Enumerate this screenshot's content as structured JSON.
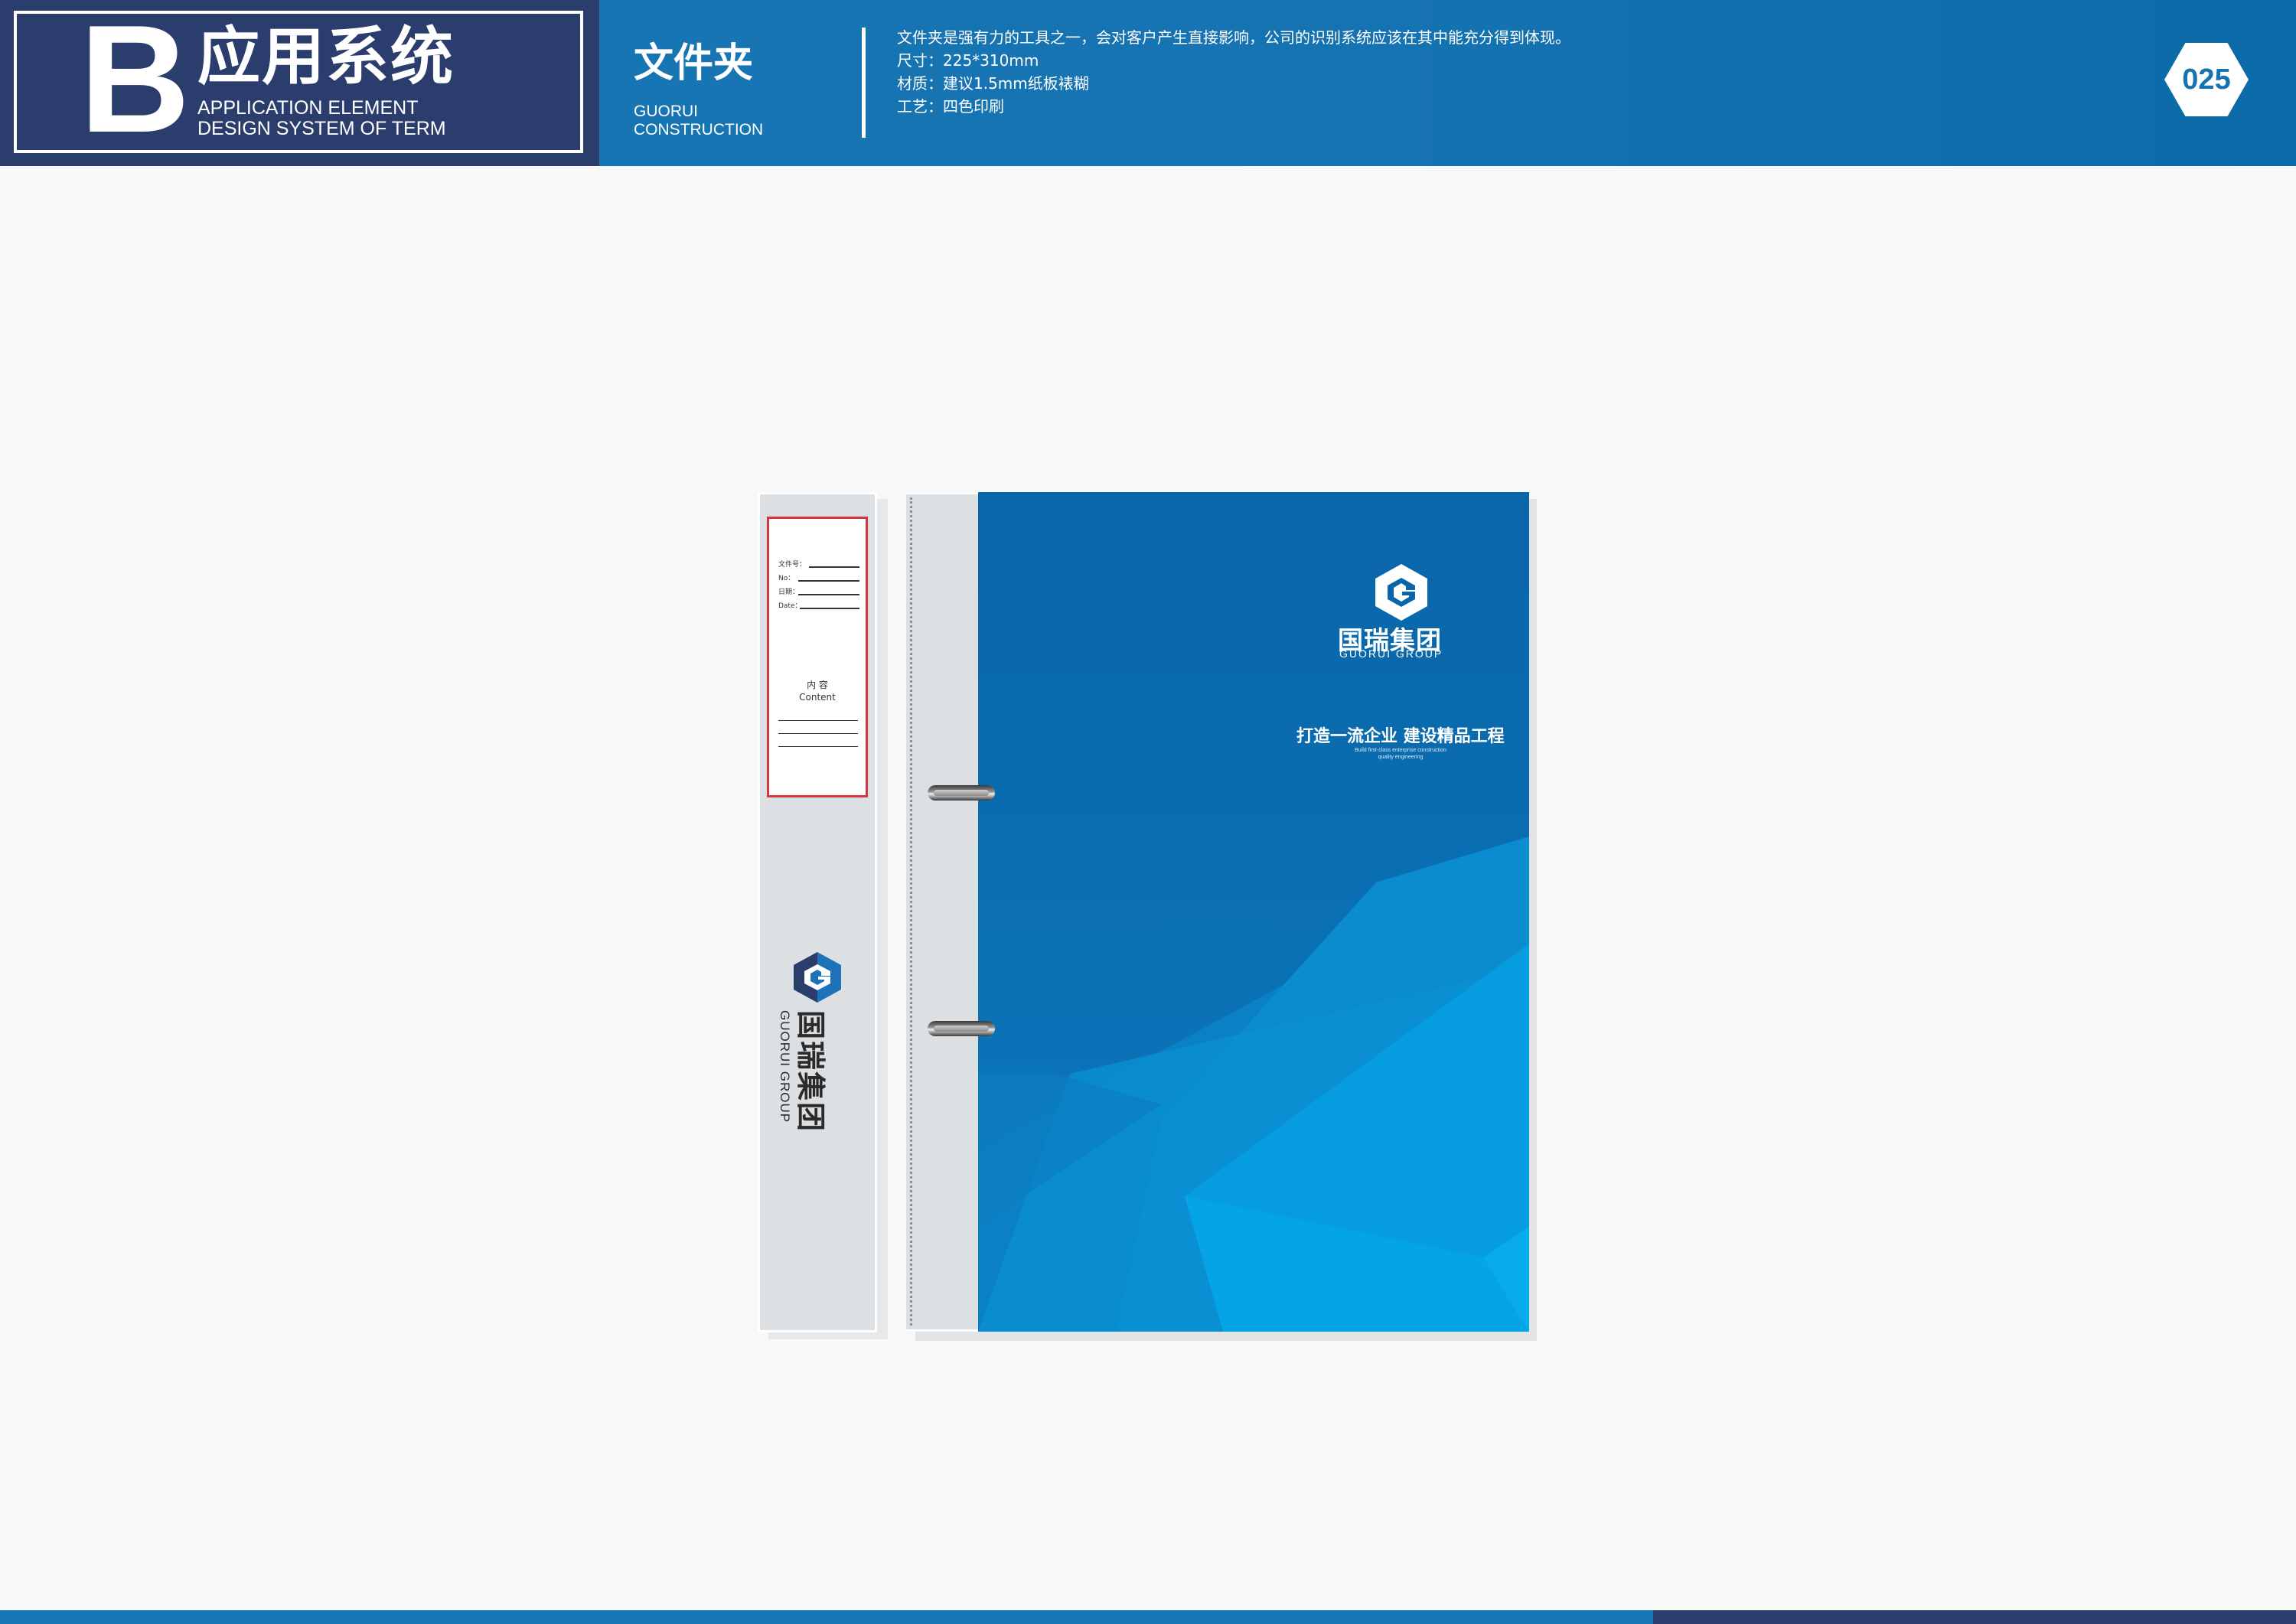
{
  "header": {
    "section_letter": "B",
    "section_title": "应用系统",
    "section_subtitle_line1": "APPLICATION ELEMENT",
    "section_subtitle_line2": "DESIGN SYSTEM OF TERM",
    "item_title": "文件夹",
    "item_sub_line1": "GUORUI",
    "item_sub_line2": "CONSTRUCTION",
    "description": [
      "文件夹是强有力的工具之一，会对客户产生直接影响，公司的识别系统应该在其中能充分得到体现。",
      "尺寸：225*310mm",
      "材质：建议1.5mm纸板裱糊",
      "工艺：四色印刷"
    ],
    "page_number": "025"
  },
  "spine": {
    "label": {
      "field1": "文件号：",
      "field2": "No：",
      "field3": "日期：",
      "field4": "Date：",
      "content_cn": "内  容",
      "content_en": "Content"
    },
    "brand_cn": "国瑞集团",
    "brand_en": "GUORUI GROUP"
  },
  "cover": {
    "brand_cn": "国瑞集团",
    "brand_en": "GUORUI GROUP",
    "slogan": "打造一流企业  建设精品工程",
    "slogan_en_line1": "Build first-class enterprise construction",
    "slogan_en_line2": "quality engineering"
  },
  "colors": {
    "header_blue": "#1673b1",
    "brand_navy": "#2b3d6c",
    "cover_blue": "#0b70b0",
    "label_red": "#d3383f"
  }
}
